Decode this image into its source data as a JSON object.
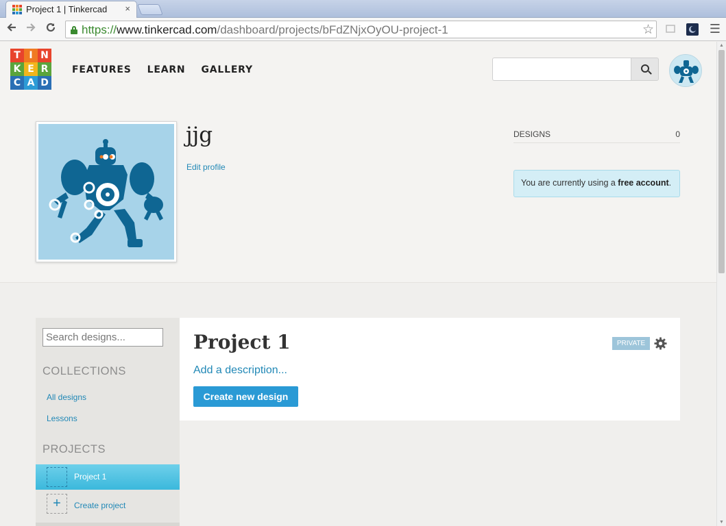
{
  "browser": {
    "tab_title": "Project 1 | Tinkercad",
    "tab_close": "×",
    "url": {
      "scheme": "https://",
      "host": "www.tinkercad.com",
      "path": "/dashboard/projects/bFdZNjxOyOU-project-1"
    },
    "icons": {
      "back": "arrow-left",
      "forward": "arrow-right",
      "reload": "reload",
      "bookmark": "star",
      "menu": "hamburger"
    }
  },
  "header": {
    "logo_letters": [
      "T",
      "I",
      "N",
      "K",
      "E",
      "R",
      "C",
      "A",
      "D"
    ],
    "nav": [
      {
        "label": "FEATURES"
      },
      {
        "label": "LEARN"
      },
      {
        "label": "GALLERY"
      }
    ],
    "search": {
      "placeholder": "",
      "value": ""
    }
  },
  "profile": {
    "username": "jjg",
    "edit_link": "Edit profile",
    "stats": {
      "label": "DESIGNS",
      "value": "0"
    },
    "account_notice": {
      "prefix": "You are currently using a ",
      "emphasis": "free account",
      "suffix": "."
    }
  },
  "sidebar": {
    "search_placeholder": "Search designs...",
    "collections_heading": "COLLECTIONS",
    "collections": [
      {
        "label": "All designs"
      },
      {
        "label": "Lessons"
      }
    ],
    "projects_heading": "PROJECTS",
    "projects": [
      {
        "label": "Project 1"
      }
    ],
    "create_project_label": "Create project",
    "create_project_symbol": "+"
  },
  "project": {
    "title": "Project 1",
    "description_link": "Add a description...",
    "create_button": "Create new design",
    "visibility": "PRIVATE"
  },
  "colors": {
    "accent": "#2a9ad5",
    "link": "#2188b6",
    "active_project": "#4fc1e1",
    "robot": "#0f6693",
    "robot_bg": "#a7d3e9"
  }
}
